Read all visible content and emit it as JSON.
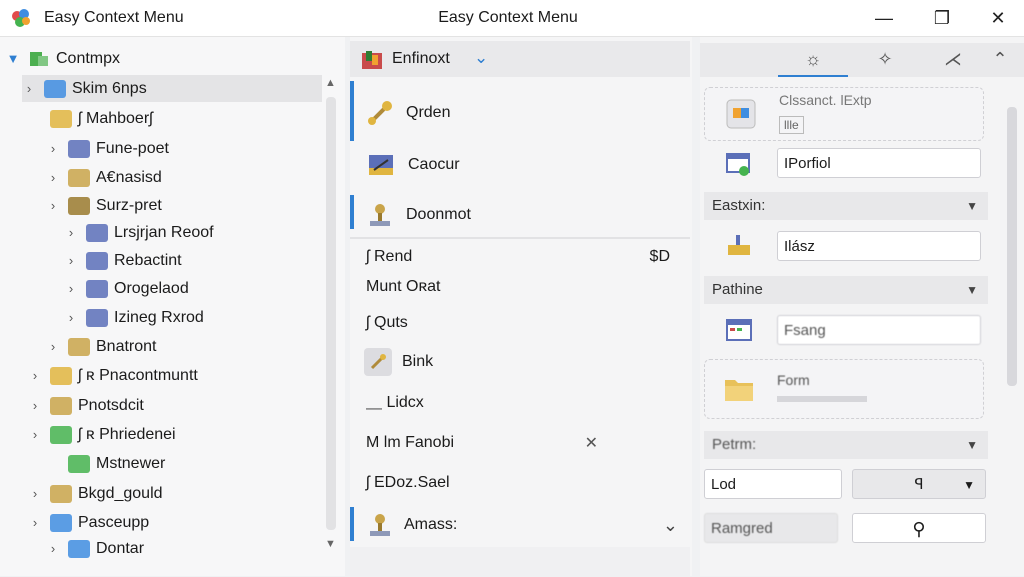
{
  "window": {
    "app_title": "Easy Context Menu",
    "center_title": "Easy Context Menu",
    "controls": {
      "minimize": "—",
      "maximize": "❐",
      "close": "✕"
    }
  },
  "tree": {
    "root": "Contmpx",
    "items": [
      {
        "label": "Skim 6nps",
        "chevron": "›"
      },
      {
        "label": "ʃ Mahboerʃ",
        "chevron": ""
      },
      {
        "label": "Fune-poet",
        "chevron": "›"
      },
      {
        "label": "A€nasisd",
        "chevron": "›"
      },
      {
        "label": "Surz-pret",
        "chevron": "›"
      },
      {
        "label": "Lrsjrjan Reoof",
        "chevron": "›"
      },
      {
        "label": "Rebactint",
        "chevron": "›"
      },
      {
        "label": "Orogelaod",
        "chevron": "›"
      },
      {
        "label": "Izineg Rxrod",
        "chevron": "›"
      },
      {
        "label": "Bnatront",
        "chevron": "›"
      },
      {
        "label": "ʃ ʀ Pnacontmuntt",
        "chevron": "›"
      },
      {
        "label": "Pnotsdcit",
        "chevron": "›"
      },
      {
        "label": "ʃ ʀ Phriedenei",
        "chevron": "›"
      },
      {
        "label": "Mstnewer",
        "chevron": ""
      },
      {
        "label": "Bkgd_gould",
        "chevron": "›"
      },
      {
        "label": "Pasceupp",
        "chevron": "›"
      },
      {
        "label": "Dontar",
        "chevron": "›"
      }
    ]
  },
  "middle": {
    "header": "Enfinoxt",
    "header_dropdown": "⌄",
    "top_items": [
      "Qrden",
      "Caocur",
      "Doonmot"
    ],
    "menu_items": [
      {
        "label": "ʃ Rend",
        "shortcut": "$D"
      },
      {
        "label": "Munt Oʀat",
        "shortcut": ""
      },
      {
        "label": "ʃ Quts",
        "shortcut": ""
      },
      {
        "label": "Bink",
        "shortcut": ""
      },
      {
        "label": "⸏ Lidcx",
        "shortcut": ""
      },
      {
        "label": "M lm Fanobi",
        "shortcut": "✕"
      },
      {
        "label": "ʃ EDoz.Sael",
        "shortcut": ""
      },
      {
        "label": "Amass:",
        "shortcut": "⌄"
      }
    ]
  },
  "right": {
    "tabs": [
      "☼",
      "✧",
      "⋌",
      "⌃"
    ],
    "card1_title": "Clssanct. lExtp",
    "card1_sub": "llle",
    "field1": "IPorfiol",
    "section1": "Eastxin:",
    "field2": "Ilász",
    "section2": "Pathine",
    "field3": "Fsang",
    "card2_title": "Form",
    "section3": "Petrm:",
    "field4": "Lod",
    "field5": "ꟼ",
    "field6": "Ramgred",
    "search_icon": "⚲"
  }
}
